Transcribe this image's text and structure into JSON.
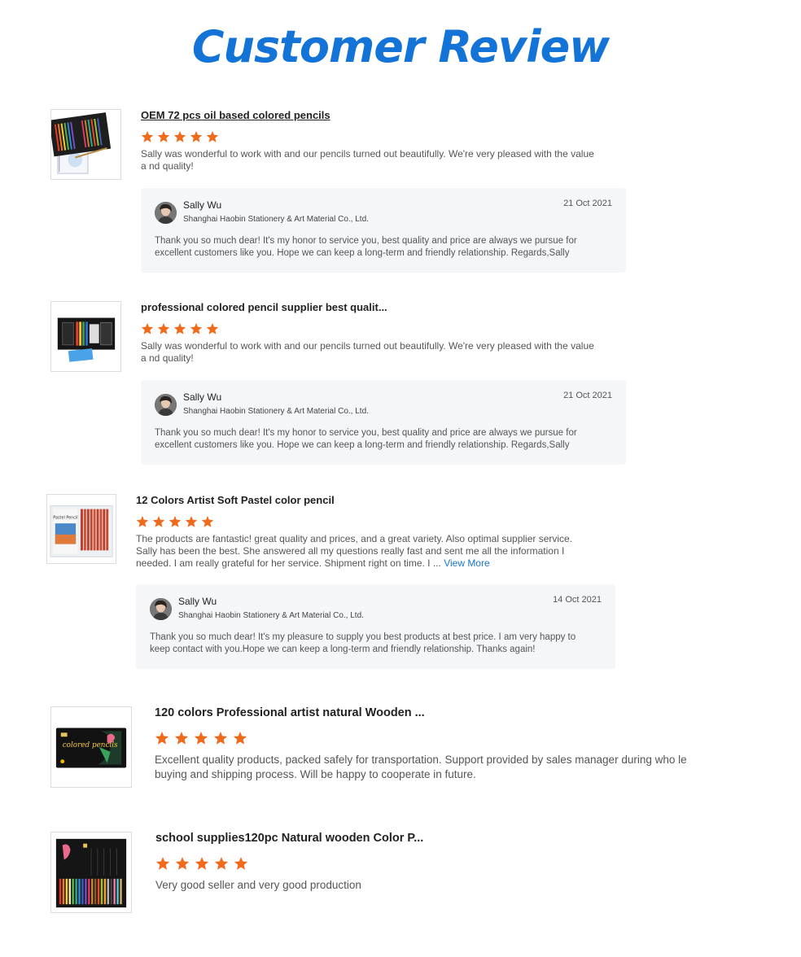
{
  "page": {
    "title": "Customer Review"
  },
  "colors": {
    "title_blue": "#1473d6",
    "star_orange": "#f06a1c",
    "link_blue": "#1a73c9",
    "reply_bg": "#f5f6f8"
  },
  "icons": {
    "rating": "star-icon",
    "seller": "avatar-photo"
  },
  "reviews": [
    {
      "product_title": "OEM 72 pcs oil based colored pencils",
      "rating": 5,
      "text": "Sally was wonderful to work with and our pencils turned out beautifully. We're very pleased with the value a nd quality!",
      "reply": {
        "seller_name": "Sally Wu",
        "company": "Shanghai Haobin Stationery & Art Material Co., Ltd.",
        "date": "21 Oct 2021",
        "text": "Thank you so much dear! It's my honor to service you, best quality and price are always we pursue for excellent customers like you. Hope we can keep a long-term and friendly relationship. Regards,Sally"
      }
    },
    {
      "product_title": "professional colored pencil supplier best qualit...",
      "rating": 5,
      "text": "Sally was wonderful to work with and our pencils turned out beautifully. We're very pleased with the value a nd quality!",
      "reply": {
        "seller_name": "Sally Wu",
        "company": "Shanghai Haobin Stationery & Art Material Co., Ltd.",
        "date": "21 Oct 2021",
        "text": "Thank you so much dear! It's my honor to service you, best quality and price are always we pursue for excellent customers like you. Hope we can keep a long-term and friendly relationship. Regards,Sally"
      }
    },
    {
      "product_title": "12 Colors Artist Soft Pastel color pencil",
      "rating": 5,
      "text": "The products are fantastic! great quality and prices, and a great variety. Also optimal supplier service. Sally has been the best. She answered all my questions really fast and sent me all the information I needed. I am really grateful for her service. Shipment right on time.  I ...",
      "view_more": "View More",
      "thumb_label": "Pastel Pencil",
      "reply": {
        "seller_name": "Sally Wu",
        "company": "Shanghai Haobin Stationery & Art Material Co., Ltd.",
        "date": "14 Oct 2021",
        "text": "Thank you so much dear! It's my pleasure to supply you best products at best price. I am very happy to keep contact with you.Hope we can keep a long-term and friendly relationship. Thanks again!"
      }
    },
    {
      "product_title": "120 colors Professional artist natural Wooden ...",
      "rating": 5,
      "text": "Excellent quality products, packed safely for transportation. Support provided by sales manager during who le buying and shipping process. Will be happy to cooperate in future.",
      "thumb_label": "colored pencils"
    },
    {
      "product_title": "school supplies120pc Natural wooden Color P...",
      "rating": 5,
      "text": "Very good seller and very good production"
    }
  ]
}
